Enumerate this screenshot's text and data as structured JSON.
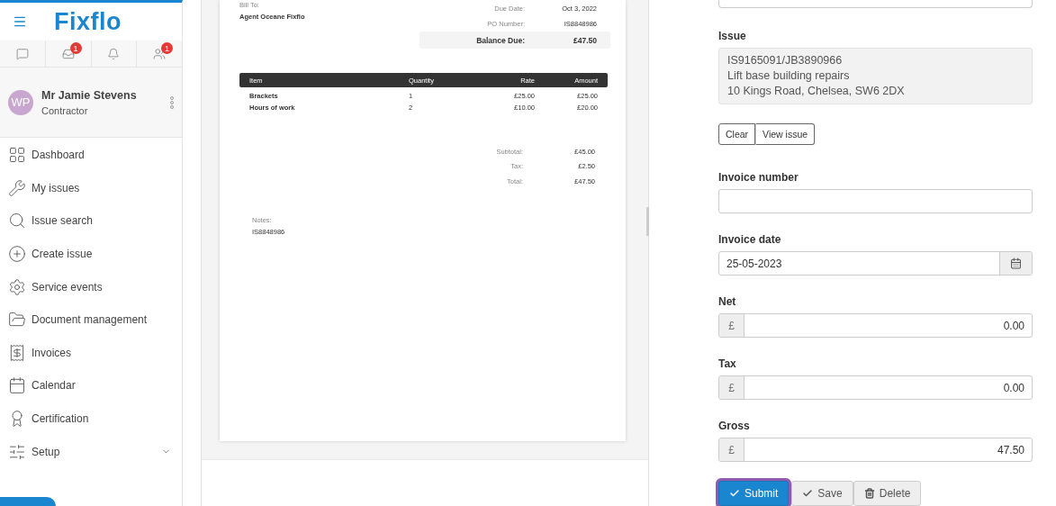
{
  "sidebar": {
    "logo": "Fixflo",
    "quick_icons": [
      {
        "has_badge": false
      },
      {
        "has_badge": true,
        "badge": "1"
      },
      {
        "has_badge": false
      },
      {
        "has_badge": true,
        "badge": "1"
      }
    ],
    "user": {
      "initials": "WP",
      "name": "Mr Jamie Stevens",
      "role": "Contractor"
    },
    "nav": [
      {
        "label": "Dashboard",
        "has_submenu": false
      },
      {
        "label": "My issues",
        "has_submenu": false
      },
      {
        "label": "Issue search",
        "has_submenu": false
      },
      {
        "label": "Create issue",
        "has_submenu": false
      },
      {
        "label": "Service events",
        "has_submenu": false
      },
      {
        "label": "Document management",
        "has_submenu": false
      },
      {
        "label": "Invoices",
        "has_submenu": false
      },
      {
        "label": "Calendar",
        "has_submenu": false
      },
      {
        "label": "Certification",
        "has_submenu": false
      },
      {
        "label": "Setup",
        "has_submenu": true
      }
    ]
  },
  "invoice_preview": {
    "bill_to_label": "Bill To:",
    "bill_to": "Agent Oceane Fixflo",
    "meta": [
      {
        "label": "Due Date:",
        "value": "Oct 3, 2022"
      },
      {
        "label": "PO Number:",
        "value": "IS8848986"
      }
    ],
    "balance": {
      "label": "Balance Due:",
      "value": "£47.50"
    },
    "columns": [
      "Item",
      "Quantity",
      "Rate",
      "Amount"
    ],
    "rows": [
      [
        "Brackets",
        "1",
        "£25.00",
        "£25.00"
      ],
      [
        "Hours of work",
        "2",
        "£10.00",
        "£20.00"
      ]
    ],
    "totals": [
      {
        "label": "Subtotal:",
        "value": "£45.00"
      },
      {
        "label": "Tax:",
        "value": "£2.50"
      },
      {
        "label": "Total:",
        "value": "£47.50"
      }
    ],
    "notes_label": "Notes:",
    "notes": "IS8848986"
  },
  "form": {
    "issue": {
      "label": "Issue",
      "lines": [
        "IS9165091/JB3890966",
        "Lift base building repairs",
        "10 Kings Road, Chelsea, SW6 2DX"
      ]
    },
    "issue_buttons": [
      "Clear",
      "View issue"
    ],
    "fields": [
      {
        "kind": "text",
        "label": "Invoice number"
      },
      {
        "kind": "date",
        "label": "Invoice date",
        "value": "25-05-2023"
      },
      {
        "kind": "currency",
        "label": "Net",
        "prefix": "£",
        "value": "0.00"
      },
      {
        "kind": "currency",
        "label": "Tax",
        "prefix": "£",
        "value": "0.00"
      },
      {
        "kind": "currency",
        "label": "Gross",
        "prefix": "£",
        "value": "47.50"
      }
    ],
    "actions": [
      {
        "kind": "submit",
        "label": "Submit",
        "focused": true
      },
      {
        "kind": "save",
        "label": "Save",
        "focused": false
      },
      {
        "kind": "delete",
        "label": "Delete",
        "focused": false
      }
    ]
  }
}
